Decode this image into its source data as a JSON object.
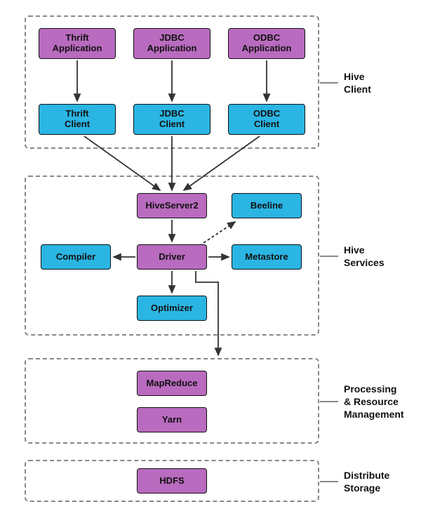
{
  "sections": {
    "client": {
      "label": "Hive\nClient"
    },
    "services": {
      "label": "Hive\nServices"
    },
    "processing": {
      "label": "Processing\n& Resource\nManagement"
    },
    "storage": {
      "label": "Distribute\nStorage"
    }
  },
  "boxes": {
    "thrift_app": "Thrift\nApplication",
    "jdbc_app": "JDBC\nApplication",
    "odbc_app": "ODBC\nApplication",
    "thrift_client": "Thrift\nClient",
    "jdbc_client": "JDBC\nClient",
    "odbc_client": "ODBC\nClient",
    "hiveserver2": "HiveServer2",
    "beeline": "Beeline",
    "compiler": "Compiler",
    "driver": "Driver",
    "metastore": "Metastore",
    "optimizer": "Optimizer",
    "mapreduce": "MapReduce",
    "yarn": "Yarn",
    "hdfs": "HDFS"
  },
  "colors": {
    "purple": "#b96bbf",
    "blue": "#2ab5e3",
    "border": "#888888"
  }
}
